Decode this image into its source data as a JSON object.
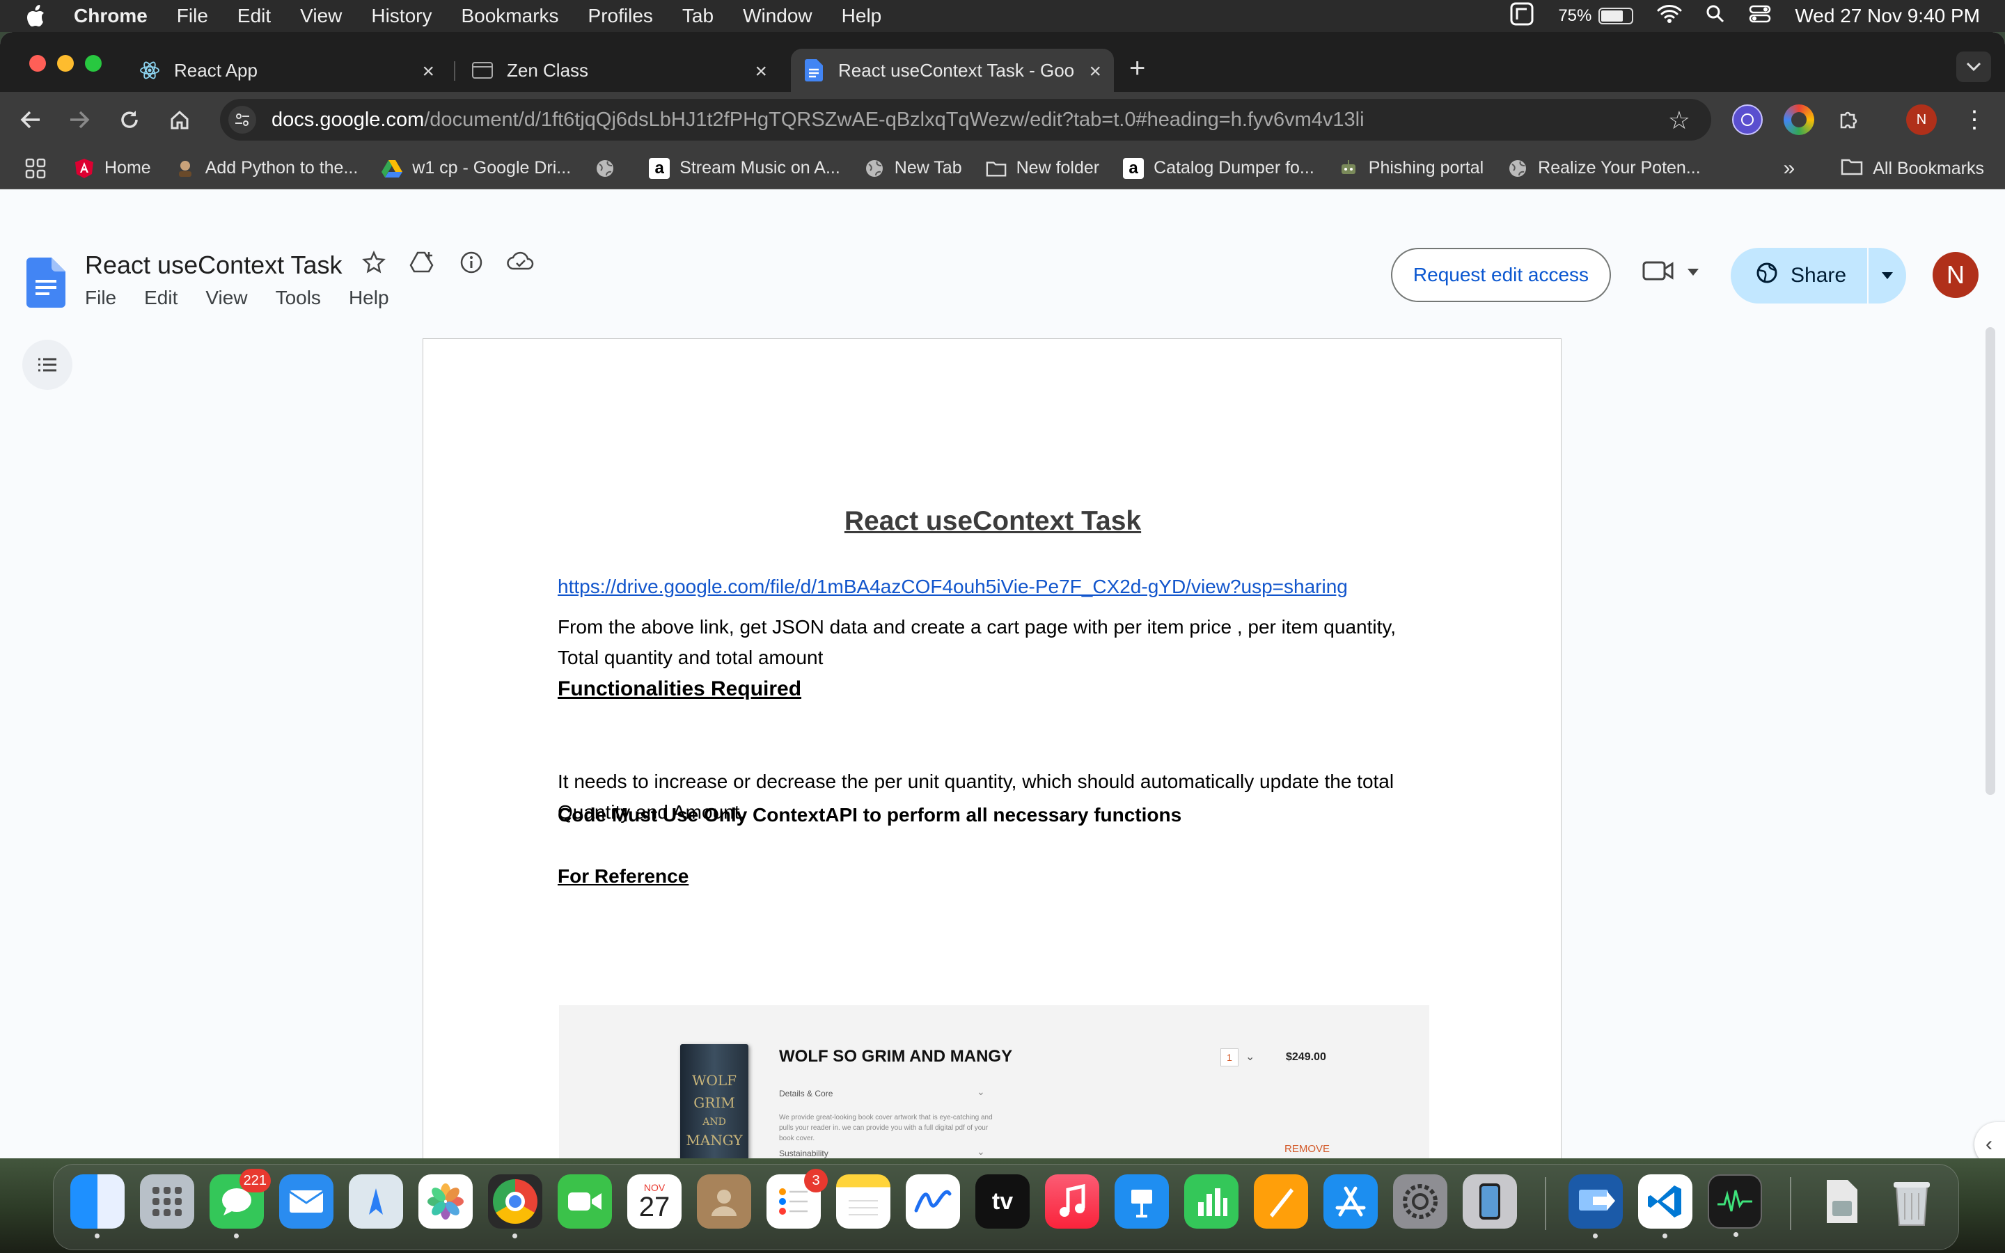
{
  "menubar": {
    "app_name": "Chrome",
    "items": [
      "File",
      "Edit",
      "View",
      "History",
      "Bookmarks",
      "Profiles",
      "Tab",
      "Window",
      "Help"
    ],
    "battery_percent": "75%",
    "battery_level": 0.75,
    "datetime": "Wed 27 Nov  9:40 PM"
  },
  "tabs": [
    {
      "title": "React App",
      "icon": "react-icon"
    },
    {
      "title": "Zen Class",
      "icon": "zen-icon"
    },
    {
      "title": "React useContext Task - Goo",
      "icon": "docs-icon",
      "active": true
    }
  ],
  "omnibox": {
    "host": "docs.google.com",
    "path": "/document/d/1ft6tjqQj6dsLbHJ1t2fPHgTQRSZwAE-qBzlxqTqWezw/edit?tab=t.0#heading=h.fyv6vm4v13li"
  },
  "profile_initial": "N",
  "bookmarks": [
    {
      "label": "Home",
      "icon": "angular-icon"
    },
    {
      "label": "Add Python to the...",
      "icon": "hacker-icon"
    },
    {
      "label": "w1 cp - Google Dri...",
      "icon": "drive-icon"
    },
    {
      "label": "",
      "icon": "globe-icon"
    },
    {
      "label": "Stream Music on A...",
      "icon": "amazon-icon"
    },
    {
      "label": "New Tab",
      "icon": "globe-icon"
    },
    {
      "label": "New folder",
      "icon": "folder-icon"
    },
    {
      "label": "Catalog Dumper fo...",
      "icon": "amazon-icon"
    },
    {
      "label": "Phishing portal",
      "icon": "robot-icon"
    },
    {
      "label": "Realize Your Poten...",
      "icon": "globe-icon"
    }
  ],
  "all_bookmarks_label": "All Bookmarks",
  "docs": {
    "title": "React useContext Task",
    "menu": [
      "File",
      "Edit",
      "View",
      "Tools",
      "Help"
    ],
    "request_edit_label": "Request edit access",
    "share_label": "Share",
    "avatar_initial": "N"
  },
  "document": {
    "heading": "React useContext Task",
    "link": "https://drive.google.com/file/d/1mBA4azCOF4ouh5iVie-Pe7F_CX2d-gYD/view?usp=sharing",
    "para1_line1": "From the above link, get JSON data and create a cart page with per item price , per item quantity,",
    "para1_line2": "Total quantity and total amount",
    "functionalities_heading": "Functionalities Required",
    "para2_line1": "It needs to increase or decrease the per unit quantity, which should automatically update the total",
    "para2_line2": "Quantity and Amount.",
    "context_note": "Code Must Use Only ContextAPI  to perform all necessary functions",
    "reference_heading": "For Reference"
  },
  "reference_image": {
    "product_title": "WOLF SO GRIM  AND MANGY",
    "book_cover_lines": [
      "WOLF",
      "GRIM",
      "AND",
      "MANGY"
    ],
    "details_label": "Details & Core",
    "description": "We provide great-looking book cover artwork that is eye-catching and pulls your reader in. we can provide you with a full digital pdf of your book cover.",
    "sustainability_label": "Sustainability",
    "quantity": "1",
    "price": "$249.00",
    "remove_label": "REMOVE"
  },
  "dock": {
    "messages_badge": "221",
    "reminders_badge": "3",
    "calendar_month": "NOV",
    "calendar_day": "27",
    "tv_label": "tv"
  }
}
